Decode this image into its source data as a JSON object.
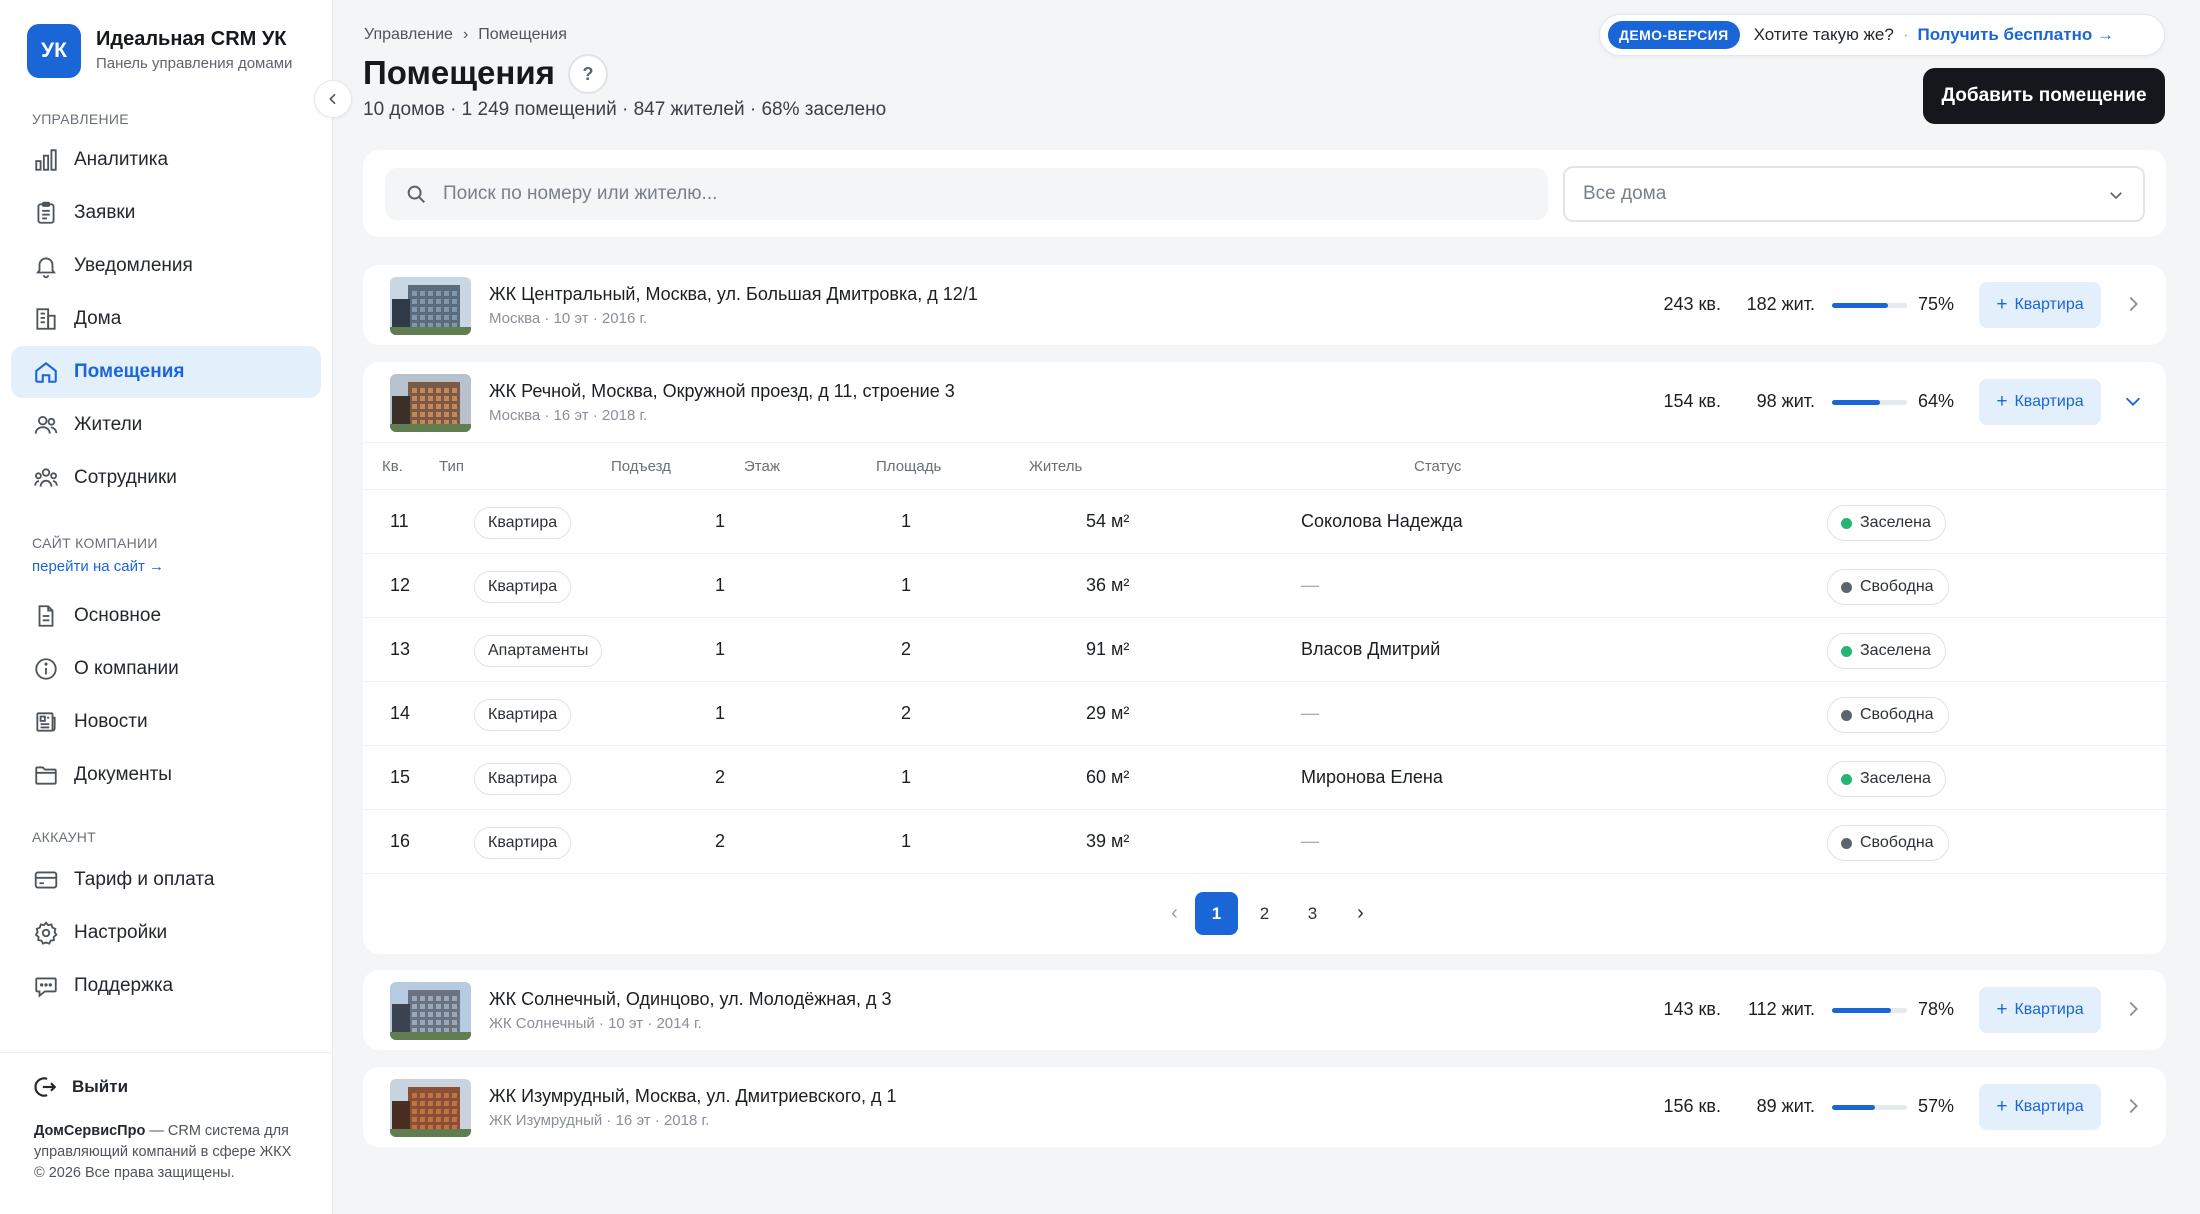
{
  "brand": {
    "logo": "УК",
    "name": "Идеальная CRM УК",
    "subtitle": "Панель управления домами"
  },
  "sidebar": {
    "section_manage": "УПРАВЛЕНИЕ",
    "manage_items": [
      {
        "label": "Аналитика",
        "icon": "bar-chart-icon"
      },
      {
        "label": "Заявки",
        "icon": "clipboard-icon"
      },
      {
        "label": "Уведомления",
        "icon": "bell-icon"
      },
      {
        "label": "Дома",
        "icon": "building-icon"
      },
      {
        "label": "Помещения",
        "icon": "home-icon",
        "active": true
      },
      {
        "label": "Жители",
        "icon": "users-icon"
      },
      {
        "label": "Сотрудники",
        "icon": "team-icon"
      }
    ],
    "section_site": "САЙТ КОМПАНИИ",
    "site_link": "перейти на сайт →",
    "site_items": [
      {
        "label": "Основное",
        "icon": "document-icon"
      },
      {
        "label": "О компании",
        "icon": "info-icon"
      },
      {
        "label": "Новости",
        "icon": "newspaper-icon"
      },
      {
        "label": "Документы",
        "icon": "folder-icon"
      }
    ],
    "section_account": "АККАУНТ",
    "account_items": [
      {
        "label": "Тариф и оплата",
        "icon": "credit-card-icon"
      },
      {
        "label": "Настройки",
        "icon": "gear-icon"
      },
      {
        "label": "Поддержка",
        "icon": "chat-icon"
      }
    ],
    "logout": "Выйти",
    "footer_brand": "ДомСервисПро",
    "footer_text": " — CRM система для управляющий компаний в сфере ЖКХ",
    "footer_copy": "© 2026 Все права защищены."
  },
  "header": {
    "breadcrumb": [
      "Управление",
      "Помещения"
    ],
    "breadcrumb_sep": "›",
    "title": "Помещения",
    "help": "?",
    "stats": "10 домов · 1 249 помещений · 847 жителей · 68% заселено",
    "demo_badge": "ДЕМО-ВЕРСИЯ",
    "demo_question": "Хотите такую же?",
    "demo_dot": "·",
    "demo_cta": "Получить бесплатно →",
    "add_button": "Добавить помещение"
  },
  "filters": {
    "search_placeholder": "Поиск по номеру или жителю...",
    "select_value": "Все дома"
  },
  "add_unit_label": "Квартира",
  "houses": [
    {
      "title": "ЖК Центральный, Москва, ул. Большая Дмитровка, д 12/1",
      "sub": "Москва · 10 эт · 2016 г.",
      "units": "243 кв.",
      "residents": "182 жит.",
      "occupancy": 75,
      "occupancy_label": "75%",
      "expanded": false
    },
    {
      "title": "ЖК Речной, Москва, Окружной проезд, д 11, строение 3",
      "sub": "Москва · 16 эт · 2018 г.",
      "units": "154 кв.",
      "residents": "98 жит.",
      "occupancy": 64,
      "occupancy_label": "64%",
      "expanded": true
    },
    {
      "title": "ЖК Солнечный, Одинцово, ул. Молодёжная, д 3",
      "sub": "ЖК Солнечный · 10 эт · 2014 г.",
      "units": "143 кв.",
      "residents": "112 жит.",
      "occupancy": 78,
      "occupancy_label": "78%",
      "expanded": false
    },
    {
      "title": "ЖК Изумрудный, Москва, ул. Дмитриевского, д 1",
      "sub": "ЖК Изумрудный · 16 эт · 2018 г.",
      "units": "156 кв.",
      "residents": "89 жит.",
      "occupancy": 57,
      "occupancy_label": "57%",
      "expanded": false
    }
  ],
  "table": {
    "columns": [
      "Кв.",
      "Тип",
      "Подъезд",
      "Этаж",
      "Площадь",
      "Житель",
      "Статус"
    ],
    "rows": [
      {
        "num": "11",
        "type": "Квартира",
        "entrance": "1",
        "floor": "1",
        "area": "54 м²",
        "resident": "Соколова Надежда",
        "status": "Заселена"
      },
      {
        "num": "12",
        "type": "Квартира",
        "entrance": "1",
        "floor": "1",
        "area": "36 м²",
        "resident": "—",
        "status": "Свободна"
      },
      {
        "num": "13",
        "type": "Апартаменты",
        "entrance": "1",
        "floor": "2",
        "area": "91 м²",
        "resident": "Власов Дмитрий",
        "status": "Заселена"
      },
      {
        "num": "14",
        "type": "Квартира",
        "entrance": "1",
        "floor": "2",
        "area": "29 м²",
        "resident": "—",
        "status": "Свободна"
      },
      {
        "num": "15",
        "type": "Квартира",
        "entrance": "2",
        "floor": "1",
        "area": "60 м²",
        "resident": "Миронова Елена",
        "status": "Заселена"
      },
      {
        "num": "16",
        "type": "Квартира",
        "entrance": "2",
        "floor": "1",
        "area": "39 м²",
        "resident": "—",
        "status": "Свободна"
      }
    ],
    "status_colors": {
      "Заселена": "#22b573",
      "Свободна": "#5e646d"
    }
  },
  "pagination": {
    "prev": "‹",
    "pages": [
      "1",
      "2",
      "3"
    ],
    "current": "1",
    "next": "›"
  },
  "colors": {
    "accent": "#1a66d6",
    "active_bg": "#e4effc",
    "dark_button": "#14171c"
  }
}
